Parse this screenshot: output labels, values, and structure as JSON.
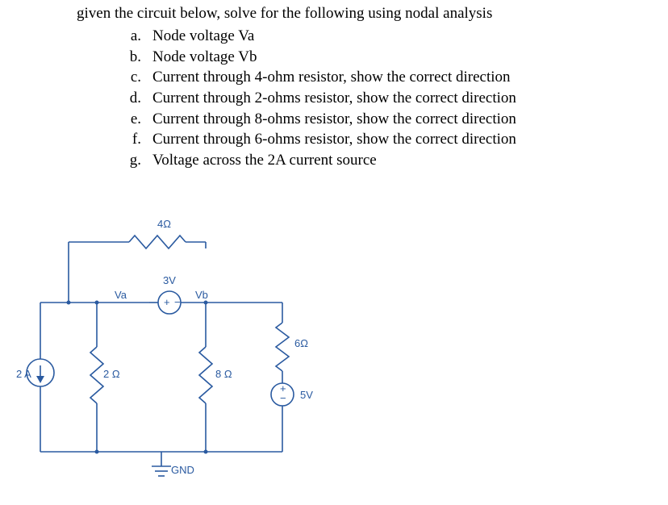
{
  "problem": {
    "stem": "given the circuit below, solve for the following using nodal analysis",
    "items": [
      {
        "label": "a.",
        "text": "Node voltage Va"
      },
      {
        "label": "b.",
        "text": "Node voltage Vb"
      },
      {
        "label": "c.",
        "text": "Current through 4-ohm resistor, show the correct direction"
      },
      {
        "label": "d.",
        "text": "Current through 2-ohms resistor, show the correct direction"
      },
      {
        "label": "e.",
        "text": "Current through 8-ohms resistor, show the correct direction"
      },
      {
        "label": "f.",
        "text": "Current through 6-ohms resistor, show the correct direction"
      },
      {
        "label": "g.",
        "text": "Voltage across the 2A current source"
      }
    ]
  },
  "circuit": {
    "r4": "4Ω",
    "r2": "2 Ω",
    "r8": "8 Ω",
    "r6": "6Ω",
    "vs3": "3V",
    "vs5": "5V",
    "is2": "2 A",
    "node_a": "Va",
    "node_b": "Vb",
    "gnd": "GND"
  },
  "chart_data": {
    "type": "circuit-schematic",
    "nodes": [
      "Va",
      "Vb",
      "GND",
      "TopLeft",
      "TopRight"
    ],
    "elements": [
      {
        "kind": "current_source",
        "value_A": 2,
        "from": "Va",
        "to": "GND",
        "arrow": "down"
      },
      {
        "kind": "resistor",
        "value_ohm": 2,
        "from": "Va",
        "to": "GND"
      },
      {
        "kind": "resistor",
        "value_ohm": 4,
        "from": "TopLeft(Va)",
        "to": "TopRight(Vb)"
      },
      {
        "kind": "voltage_source",
        "value_V": 3,
        "plus": "Va",
        "minus": "Vb"
      },
      {
        "kind": "resistor",
        "value_ohm": 8,
        "from": "Vb",
        "to": "GND"
      },
      {
        "kind": "resistor",
        "value_ohm": 6,
        "from": "Vb",
        "to": "X"
      },
      {
        "kind": "voltage_source",
        "value_V": 5,
        "plus": "X",
        "minus": "GND"
      }
    ],
    "reference": "GND"
  }
}
